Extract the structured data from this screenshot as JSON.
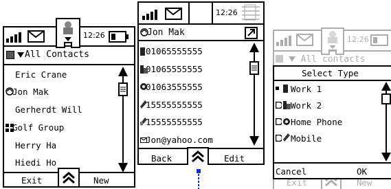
{
  "left_screen": {
    "time": "12:26",
    "header": "All Contacts",
    "contacts": [
      "Eric Crane",
      "Jon Mak",
      "Gerherdt Will",
      "Golf Group",
      "Herry Ha",
      "Hiedi Ho"
    ],
    "softkeys": {
      "left": "Exit",
      "right": "New"
    }
  },
  "middle_screen": {
    "time": "12:26",
    "header": "Jon Mak",
    "details": [
      {
        "icon": "work-phone-icon",
        "value": "01065555555"
      },
      {
        "icon": "work2-phone-icon",
        "value": "01065555555"
      },
      {
        "icon": "home-phone-icon",
        "value": "01063555555"
      },
      {
        "icon": "mobile-phone-icon",
        "value": "15555555555"
      },
      {
        "icon": "mobile2-phone-icon",
        "value": "15555555555"
      },
      {
        "icon": "email-icon",
        "value": "Jon@yahoo.com"
      }
    ],
    "softkeys": {
      "left": "Back",
      "right": "Edit"
    }
  },
  "right_screen": {
    "time": "12:26",
    "bg_header": "All contacts",
    "bg_softkeys": {
      "left": "Exit",
      "right": "New"
    },
    "dialog": {
      "title": "Select Type",
      "options": [
        "Work 1",
        "Work 2",
        "Home Phone",
        "Mobile"
      ],
      "cancel": "Cancel",
      "ok": "OK"
    }
  }
}
